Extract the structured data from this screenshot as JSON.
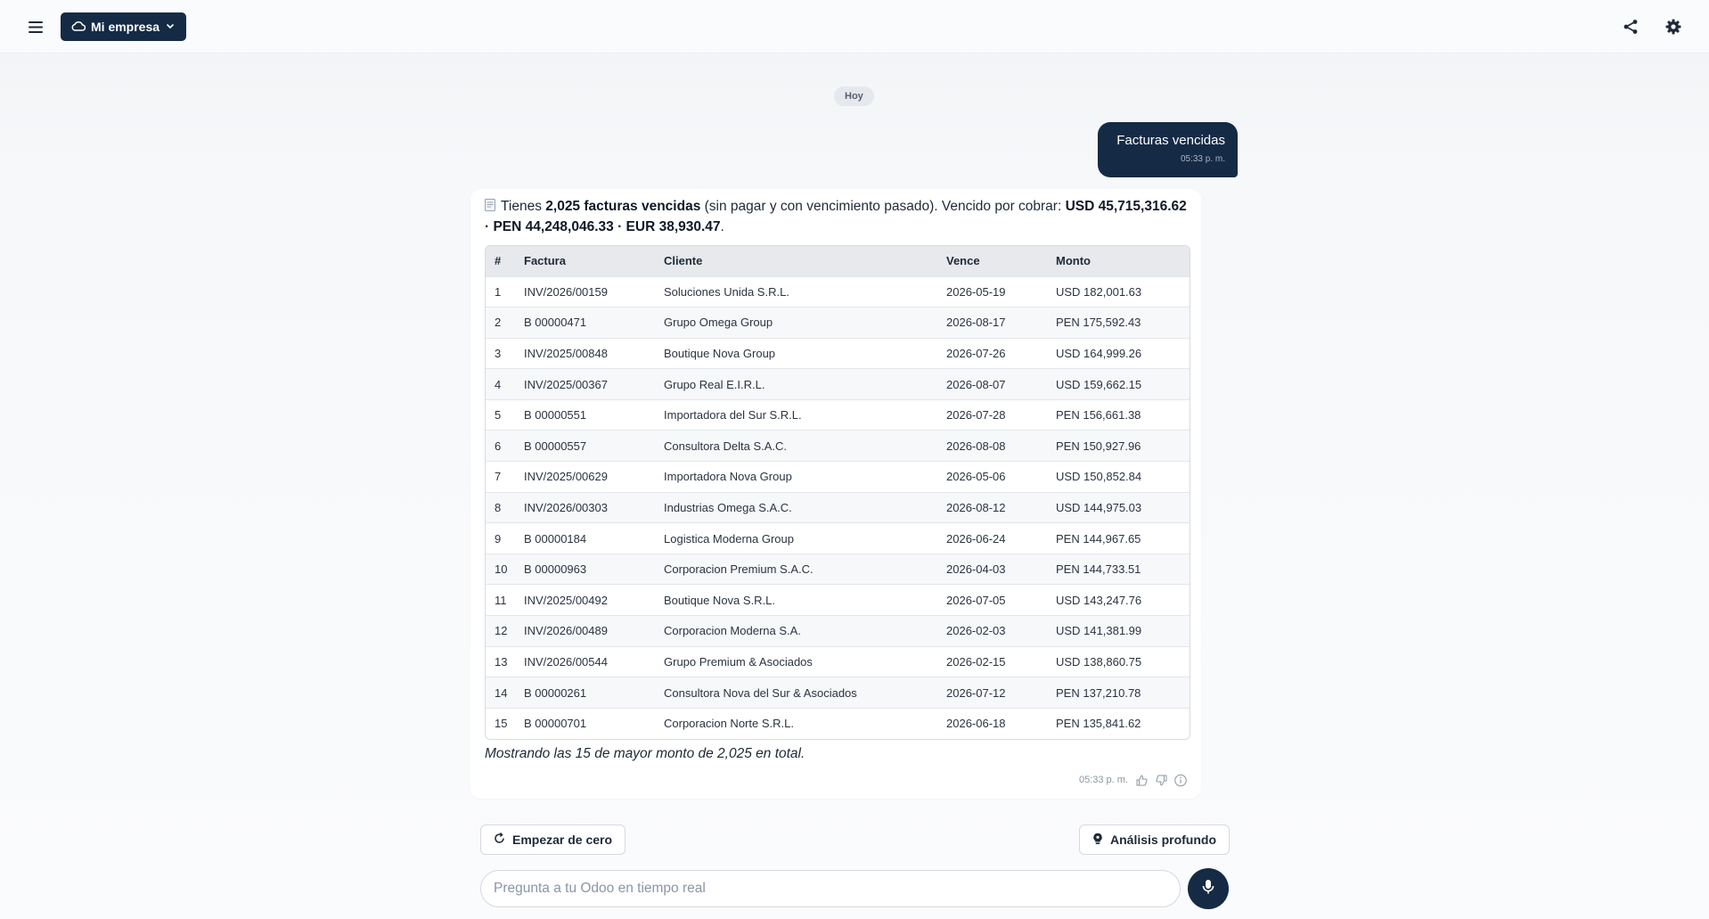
{
  "header": {
    "company_label": "Mi empresa",
    "icons": {
      "menu": "menu-icon",
      "cloud": "cloud-icon",
      "chevron": "chevron-down-icon",
      "share": "share-icon",
      "settings": "gear-icon"
    }
  },
  "chat": {
    "date_chip": "Hoy",
    "user_message": {
      "text": "Facturas vencidas",
      "time": "05:33 p. m."
    },
    "bot_message": {
      "summary": {
        "prefix": "Tienes ",
        "count_bold": "2,025 facturas vencidas",
        "middle": " (sin pagar y con vencimiento pasado). Vencido por cobrar: ",
        "totals_bold": "USD 45,715,316.62 · PEN 44,248,046.33 · EUR 38,930.47",
        "suffix": "."
      },
      "table": {
        "headers": [
          "#",
          "Factura",
          "Cliente",
          "Vence",
          "Monto"
        ],
        "rows": [
          [
            "1",
            "INV/2026/00159",
            "Soluciones Unida S.R.L.",
            "2026-05-19",
            "USD 182,001.63"
          ],
          [
            "2",
            "B 00000471",
            "Grupo Omega Group",
            "2026-08-17",
            "PEN 175,592.43"
          ],
          [
            "3",
            "INV/2025/00848",
            "Boutique Nova Group",
            "2026-07-26",
            "USD 164,999.26"
          ],
          [
            "4",
            "INV/2025/00367",
            "Grupo Real E.I.R.L.",
            "2026-08-07",
            "USD 159,662.15"
          ],
          [
            "5",
            "B 00000551",
            "Importadora del Sur S.R.L.",
            "2026-07-28",
            "PEN 156,661.38"
          ],
          [
            "6",
            "B 00000557",
            "Consultora Delta S.A.C.",
            "2026-08-08",
            "PEN 150,927.96"
          ],
          [
            "7",
            "INV/2025/00629",
            "Importadora Nova Group",
            "2026-05-06",
            "USD 150,852.84"
          ],
          [
            "8",
            "INV/2026/00303",
            "Industrias Omega S.A.C.",
            "2026-08-12",
            "USD 144,975.03"
          ],
          [
            "9",
            "B 00000184",
            "Logistica Moderna Group",
            "2026-06-24",
            "PEN 144,967.65"
          ],
          [
            "10",
            "B 00000963",
            "Corporacion Premium S.A.C.",
            "2026-04-03",
            "PEN 144,733.51"
          ],
          [
            "11",
            "INV/2025/00492",
            "Boutique Nova S.R.L.",
            "2026-07-05",
            "USD 143,247.76"
          ],
          [
            "12",
            "INV/2026/00489",
            "Corporacion Moderna S.A.",
            "2026-02-03",
            "USD 141,381.99"
          ],
          [
            "13",
            "INV/2026/00544",
            "Grupo Premium & Asociados",
            "2026-02-15",
            "USD 138,860.75"
          ],
          [
            "14",
            "B 00000261",
            "Consultora Nova del Sur & Asociados",
            "2026-07-12",
            "PEN 137,210.78"
          ],
          [
            "15",
            "B 00000701",
            "Corporacion Norte S.R.L.",
            "2026-06-18",
            "PEN 135,841.62"
          ]
        ]
      },
      "footnote": "Mostrando las 15 de mayor monto de 2,025 en total.",
      "time": "05:33 p. m.",
      "icons": {
        "doc": "document-icon",
        "like": "thumbs-up-icon",
        "dislike": "thumbs-down-icon",
        "info": "info-icon"
      }
    }
  },
  "actions": {
    "restart_label": "Empezar de cero",
    "deep_label": "Análisis profundo",
    "input_placeholder": "Pregunta a tu Odoo en tiempo real",
    "icons": {
      "restart": "refresh-icon",
      "deep": "lightbulb-icon",
      "mic": "microphone-icon"
    }
  }
}
